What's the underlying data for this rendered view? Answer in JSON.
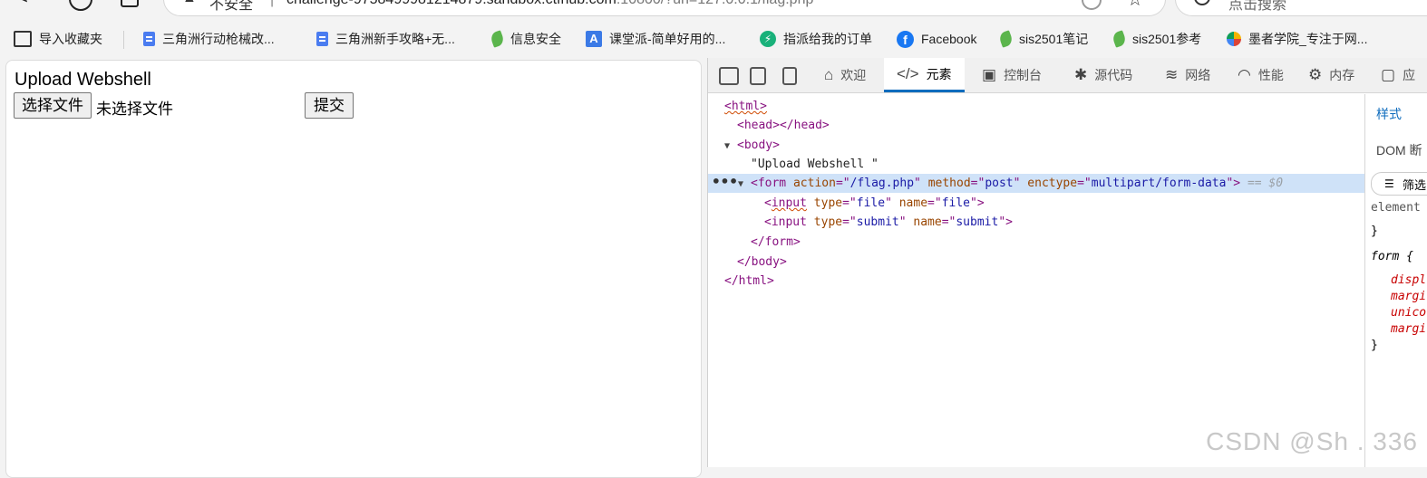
{
  "addressbar": {
    "insecure_label": "不安全",
    "separator": "|",
    "url_main": "challenge-9758499981214879.sandbox.ctfhub.com",
    "url_rest": ":10800/?url=127.0.0.1/flag.php"
  },
  "search": {
    "placeholder": "点击搜索"
  },
  "bookmarks": [
    {
      "label": "导入收藏夹",
      "icon": "import-icon"
    },
    {
      "label": "三角洲行动枪械改...",
      "icon": "doc-icon"
    },
    {
      "label": "三角洲新手攻略+无...",
      "icon": "doc-icon"
    },
    {
      "label": "信息安全",
      "icon": "leaf-icon"
    },
    {
      "label": "课堂派-简单好用的...",
      "icon": "classroom-icon"
    },
    {
      "label": "指派给我的订单",
      "icon": "bolt-icon"
    },
    {
      "label": "Facebook",
      "icon": "facebook-icon"
    },
    {
      "label": "sis2501笔记",
      "icon": "leaf-icon"
    },
    {
      "label": "sis2501参考",
      "icon": "leaf-icon"
    },
    {
      "label": "墨者学院_专注于网...",
      "icon": "flower-icon"
    }
  ],
  "page": {
    "heading": "Upload Webshell",
    "file_button": "选择文件",
    "file_status": "未选择文件",
    "submit_button": "提交"
  },
  "devtools": {
    "tabs": [
      {
        "label": "欢迎",
        "icon": "home-icon",
        "active": false
      },
      {
        "label": "元素",
        "icon": "code-icon",
        "active": true
      },
      {
        "label": "控制台",
        "icon": "console-icon",
        "active": false
      },
      {
        "label": "源代码",
        "icon": "bug-icon",
        "active": false
      },
      {
        "label": "网络",
        "icon": "wifi-icon",
        "active": false
      },
      {
        "label": "性能",
        "icon": "gauge-icon",
        "active": false
      },
      {
        "label": "内存",
        "icon": "chip-icon",
        "active": false
      },
      {
        "label": "应",
        "icon": "app-icon",
        "active": false
      }
    ],
    "dom": {
      "html_open": "<html>",
      "head": "<head></head>",
      "body_open": "<body>",
      "text_node": "\"Upload Webshell \"",
      "form_tag": "form",
      "form_action": "/flag.php",
      "form_method": "post",
      "form_enctype": "multipart/form-data",
      "selected_ref": "== $0",
      "input1_type": "file",
      "input1_name": "file",
      "input2_type": "submit",
      "input2_name": "submit",
      "form_close": "</form>",
      "body_close": "</body>",
      "html_close": "</html>"
    },
    "styles": {
      "tab_styles": "样式",
      "tab_dom": "DOM 断",
      "filter": "筛选",
      "element_rule": "element",
      "brace_close": "}",
      "form_rule": "form {",
      "props": [
        "displ",
        "margi",
        "unico",
        "margi"
      ]
    }
  },
  "watermark": "CSDN @Sh    . 336"
}
